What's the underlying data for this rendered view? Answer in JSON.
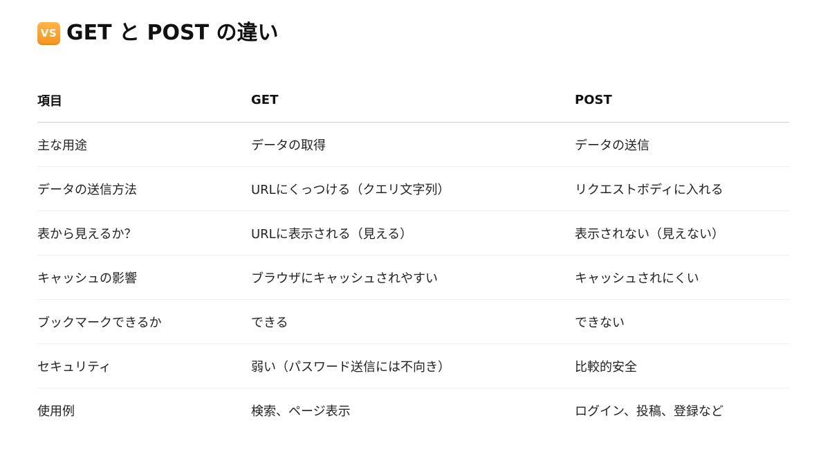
{
  "heading": {
    "icon": "vs-icon",
    "badge_text": "VS",
    "title": "GET と POST の違い"
  },
  "table": {
    "headers": [
      "項目",
      "GET",
      "POST"
    ],
    "rows": [
      [
        "主な用途",
        "データの取得",
        "データの送信"
      ],
      [
        "データの送信方法",
        "URLにくっつける（クエリ文字列）",
        "リクエストボディに入れる"
      ],
      [
        "表から見えるか？",
        "URLに表示される（見える）",
        "表示されない（見えない）"
      ],
      [
        "キャッシュの影響",
        "ブラウザにキャッシュされやすい",
        "キャッシュされにくい"
      ],
      [
        "ブックマークできるか",
        "できる",
        "できない"
      ],
      [
        "セキュリティ",
        "弱い（パスワード送信には不向き）",
        "比較的安全"
      ],
      [
        "使用例",
        "検索、ページ表示",
        "ログイン、投稿、登録など"
      ]
    ]
  },
  "colors": {
    "badge": "#f7941d",
    "header_rule": "#cfcfcf",
    "row_rule": "#eeeeee"
  }
}
